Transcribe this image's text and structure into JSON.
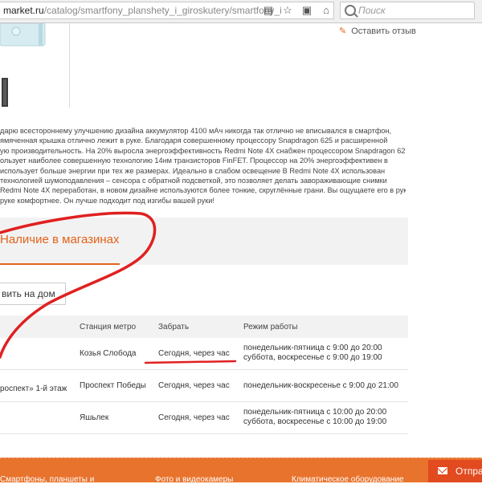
{
  "browser": {
    "url_domain": "market.ru",
    "url_path": "/catalog/smartfony_planshety_i_giroskutery/smartfony_i",
    "search_placeholder": "Поиск",
    "icons": [
      "reader-view-icon",
      "star-bookmark-icon",
      "lock-icon",
      "bookmarks-icon",
      "download-icon",
      "home-icon",
      "toggle-icon"
    ]
  },
  "product": {
    "review_link": "Оставить отзыв",
    "description_lines": [
      "дарю всестороннему улучшению дизайна аккумулятор 4100 мАч никогда так отлично не вписывался в смартфон,",
      "ямяченная крышка отлично лежит в руке. Благодаря совершенному процессору Snapdragon 625 и расширенной",
      "ую производительность. На 20% выросла энергоэффективность Redmi Note 4X снабжен процессором Snapdragon 625,",
      "ользует наиболее совершенную технологию 14нм транзисторов FinFET. Процессор на 20% энергоэффективен в",
      "использует больше энергии при тех же размерах. Идеально в слабом освещение В Redmi Note 4X использован",
      "технологией шумоподавления – сенсора с обратной подсветкой, это позволяет делать завораживающие снимки",
      "Redmi Note 4X переработан, в новом дизайне используются более тонкие, скруглённые грани. Вы ощущаете его в руке",
      "руке комфортнее. Он лучше подходит под изгибы вашей руки!"
    ]
  },
  "stores": {
    "heading": "Наличие в магазинах",
    "delivery_tab": "вить на дом",
    "columns": [
      "Станция метро",
      "Забрать",
      "Режим работы"
    ],
    "rows": [
      {
        "address": "",
        "metro": "Козья Слобода",
        "pickup": "Сегодня, через час",
        "hours": [
          "понедельник-пятница с 9:00 до 20:00",
          "суббота, воскресенье с 9:00 до 19:00"
        ]
      },
      {
        "address": "роспект» 1-й этаж",
        "metro": "Проспект Победы",
        "pickup": "Сегодня, через час",
        "hours": [
          "понедельник-воскресенье с 9:00 до 21:00"
        ]
      },
      {
        "address": "",
        "metro": "Яшьлек",
        "pickup": "Сегодня, через час",
        "hours": [
          "понедельник-пятница с 10:00 до 20:00",
          "суббота, воскресенье с 10:00 до 19:00"
        ]
      }
    ]
  },
  "footer": {
    "links": [
      "Смартфоны, планшеты и",
      "Фото и видеокамеры",
      "Климатическое оборудование"
    ],
    "send_button": "Отпра"
  },
  "colors": {
    "accent": "#e4631a",
    "footer": "#e8732d",
    "send_button": "#e24a1f",
    "annotation_red": "#e02020"
  }
}
